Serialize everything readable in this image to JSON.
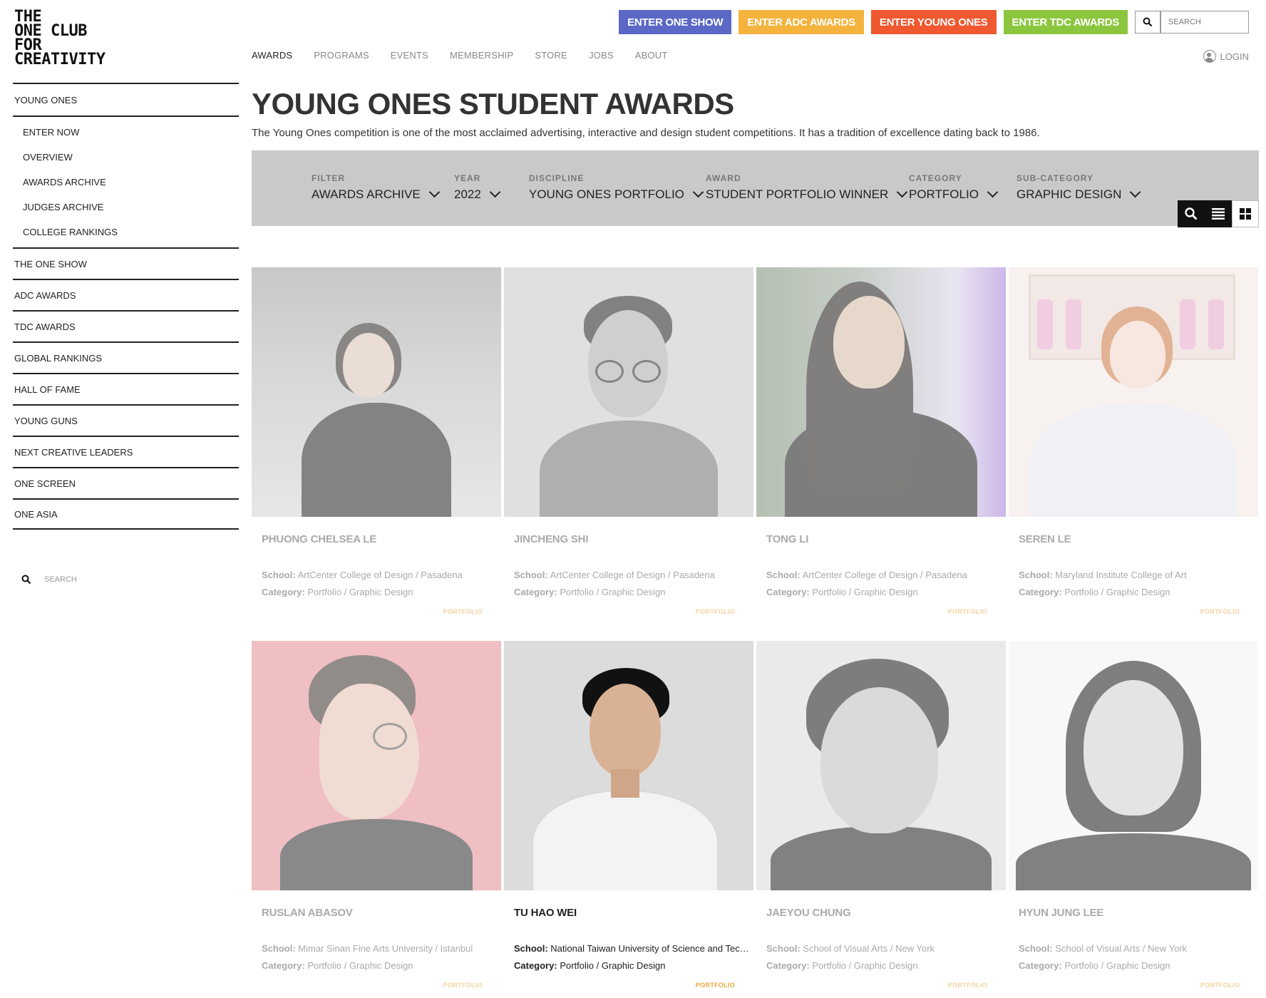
{
  "logo": {
    "lines": [
      "THE",
      "ONE CLUB",
      "FOR",
      "CREATIVITY"
    ]
  },
  "cta_buttons": [
    {
      "label": "ENTER ONE SHOW",
      "color": "#5b68c6"
    },
    {
      "label": "ENTER ADC AWARDS",
      "color": "#f4b33d"
    },
    {
      "label": "ENTER YOUNG ONES",
      "color": "#f0582f"
    },
    {
      "label": "ENTER TDC AWARDS",
      "color": "#8cc63f"
    }
  ],
  "top_search": {
    "placeholder": "SEARCH"
  },
  "topnav": [
    "AWARDS",
    "PROGRAMS",
    "EVENTS",
    "MEMBERSHIP",
    "STORE",
    "JOBS",
    "ABOUT"
  ],
  "login": "LOGIN",
  "sidebar": {
    "main_item": "YOUNG ONES",
    "sub_items": [
      "ENTER NOW",
      "OVERVIEW",
      "AWARDS ARCHIVE",
      "JUDGES ARCHIVE",
      "COLLEGE RANKINGS"
    ],
    "items": [
      "THE ONE SHOW",
      "ADC AWARDS",
      "TDC AWARDS",
      "GLOBAL RANKINGS",
      "HALL OF FAME",
      "YOUNG GUNS",
      "NEXT CREATIVE LEADERS",
      "ONE SCREEN",
      "ONE ASIA"
    ],
    "search_placeholder": "SEARCH"
  },
  "page": {
    "title": "YOUNG ONES STUDENT AWARDS",
    "description": "The Young Ones competition is one of the most acclaimed advertising, interactive and design student competitions. It has a tradition of excellence dating back to 1986."
  },
  "filters": [
    {
      "label": "FILTER",
      "value": "AWARDS ARCHIVE"
    },
    {
      "label": "YEAR",
      "value": "2022"
    },
    {
      "label": "DISCIPLINE",
      "value": "YOUNG ONES PORTFOLIO"
    },
    {
      "label": "AWARD",
      "value": "STUDENT PORTFOLIO WINNER"
    },
    {
      "label": "CATEGORY",
      "value": "PORTFOLIO"
    },
    {
      "label": "SUB-CATEGORY",
      "value": "GRAPHIC DESIGN"
    }
  ],
  "card_labels": {
    "school": "School:",
    "category": "Category:"
  },
  "cards": [
    {
      "name": "PHUONG CHELSEA LE",
      "school": "ArtCenter College of Design / Pasadena",
      "category": "Portfolio / Graphic Design",
      "tag": "PORTFOLIO"
    },
    {
      "name": "JINCHENG SHI",
      "school": "ArtCenter College of Design / Pasadena",
      "category": "Portfolio / Graphic Design",
      "tag": "PORTFOLIO"
    },
    {
      "name": "TONG LI",
      "school": "ArtCenter College of Design / Pasadena",
      "category": "Portfolio / Graphic Design",
      "tag": "PORTFOLIO"
    },
    {
      "name": "SEREN LE",
      "school": "Maryland Institute College of Art",
      "category": "Portfolio / Graphic Design",
      "tag": "PORTFOLIO"
    },
    {
      "name": "RUSLAN ABASOV",
      "school": "Mimar Sinan Fine Arts University / Istanbul",
      "category": "Portfolio / Graphic Design",
      "tag": "PORTFOLIO"
    },
    {
      "name": "TU HAO WEI",
      "school": "National Taiwan University of Science and Technol...",
      "category": "Portfolio / Graphic Design",
      "tag": "PORTFOLIO"
    },
    {
      "name": "JAEYOU CHUNG",
      "school": "School of Visual Arts / New York",
      "category": "Portfolio / Graphic Design",
      "tag": "PORTFOLIO"
    },
    {
      "name": "HYUN JUNG LEE",
      "school": "School of Visual Arts / New York",
      "category": "Portfolio / Graphic Design",
      "tag": "PORTFOLIO"
    }
  ]
}
